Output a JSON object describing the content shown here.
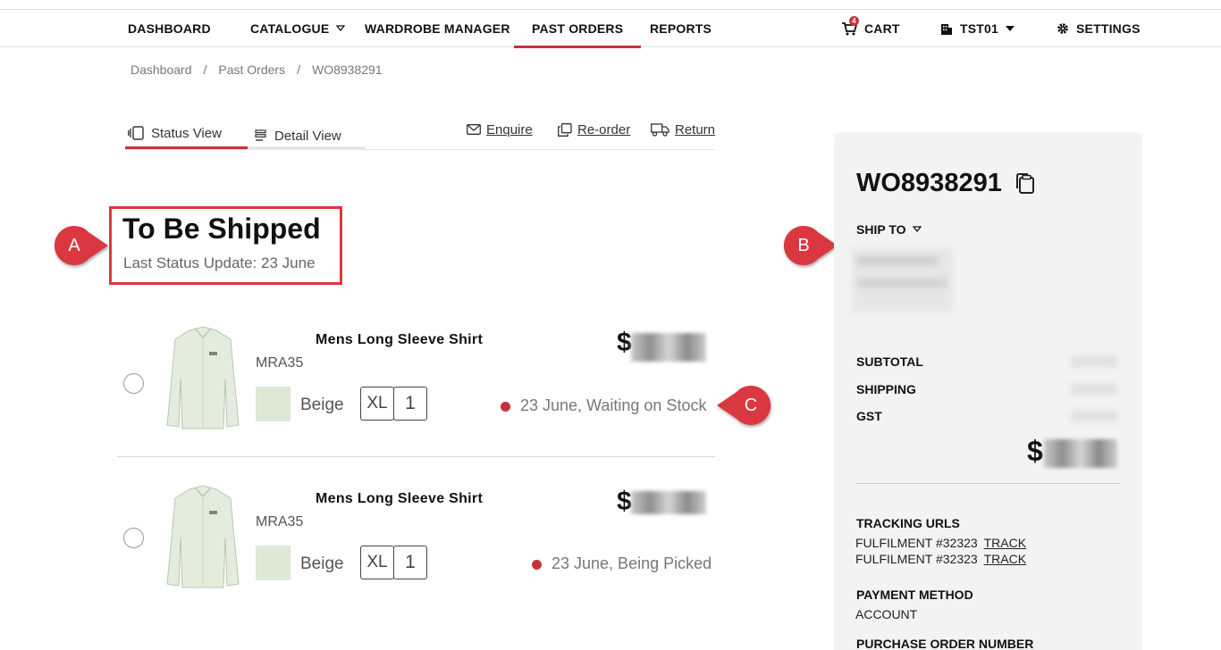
{
  "nav": {
    "items": [
      {
        "label": "DASHBOARD"
      },
      {
        "label": "CATALOGUE"
      },
      {
        "label": "WARDROBE MANAGER"
      },
      {
        "label": "PAST ORDERS"
      },
      {
        "label": "REPORTS"
      }
    ],
    "active": "PAST ORDERS",
    "cart_label": "CART",
    "cart_count": "4",
    "account_label": "TST01",
    "settings_label": "SETTINGS"
  },
  "breadcrumb": [
    "Dashboard",
    "Past Orders",
    "WO8938291"
  ],
  "tabs": [
    {
      "label": "Status View",
      "active": true
    },
    {
      "label": "Detail View",
      "active": false
    }
  ],
  "actions": [
    {
      "label": "Enquire",
      "icon": "envelope-icon"
    },
    {
      "label": "Re-order",
      "icon": "copy-icon"
    },
    {
      "label": "Return",
      "icon": "truck-icon"
    }
  ],
  "status_group": {
    "title": "To Be Shipped",
    "subtitle": "Last Status Update: 23 June"
  },
  "callouts": {
    "a": "A",
    "b": "B",
    "c": "C"
  },
  "line_items": [
    {
      "name": "Mens Long Sleeve Shirt",
      "sku": "MRA35",
      "color": "Beige",
      "size": "XL",
      "qty": "1",
      "currency": "$",
      "status": "23 June, Waiting on Stock"
    },
    {
      "name": "Mens Long Sleeve Shirt",
      "sku": "MRA35",
      "color": "Beige",
      "size": "XL",
      "qty": "1",
      "currency": "$",
      "status": "23 June, Being Picked"
    }
  ],
  "summary": {
    "order_number": "WO8938291",
    "ship_to_label": "SHIP TO",
    "subtotal_label": "SUBTOTAL",
    "shipping_label": "SHIPPING",
    "gst_label": "GST",
    "total_currency": "$",
    "tracking_title": "TRACKING URLS",
    "tracking": [
      {
        "text": "FULFILMENT #32323",
        "link": "TRACK"
      },
      {
        "text": "FULFILMENT #32323",
        "link": "TRACK"
      }
    ],
    "payment_title": "PAYMENT METHOD",
    "payment_value": "ACCOUNT",
    "po_title": "PURCHASE ORDER NUMBER"
  },
  "colors": {
    "accent": "#c8313c",
    "swatch_beige": "#dde8d6",
    "panel_bg": "#f3f3f3"
  }
}
